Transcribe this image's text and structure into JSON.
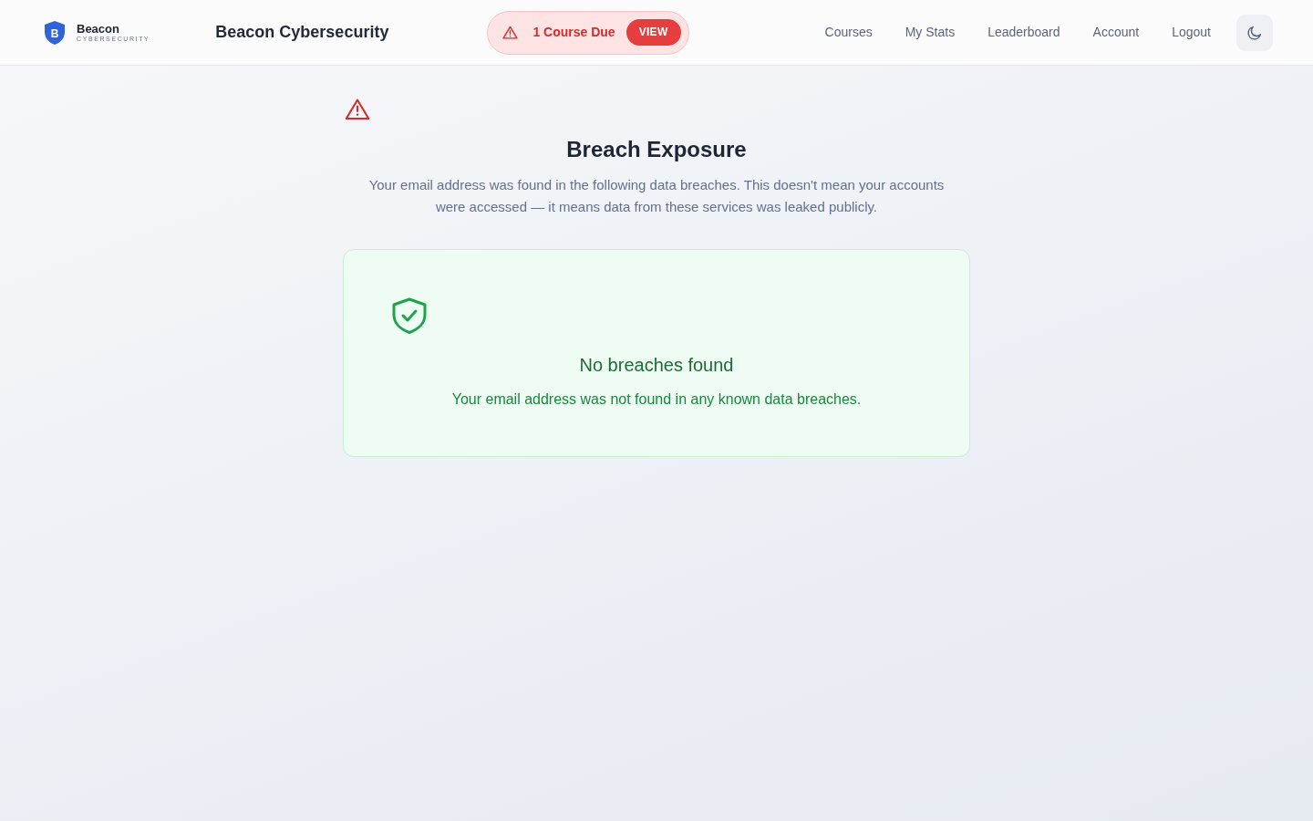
{
  "header": {
    "logo": {
      "mark": "B",
      "name": "Beacon",
      "tagline": "CYBERSECURITY"
    },
    "title": "Beacon Cybersecurity",
    "alert": {
      "text": "1 Course Due",
      "action": "VIEW"
    },
    "nav": [
      "Courses",
      "My Stats",
      "Leaderboard",
      "Account",
      "Logout"
    ]
  },
  "main": {
    "title": "Breach Exposure",
    "description": "Your email address was found in the following data breaches. This doesn't mean your accounts were accessed — it means data from these services was leaked publicly.",
    "result": {
      "title": "No breaches found",
      "message": "Your email address was not found in any known data breaches."
    }
  }
}
